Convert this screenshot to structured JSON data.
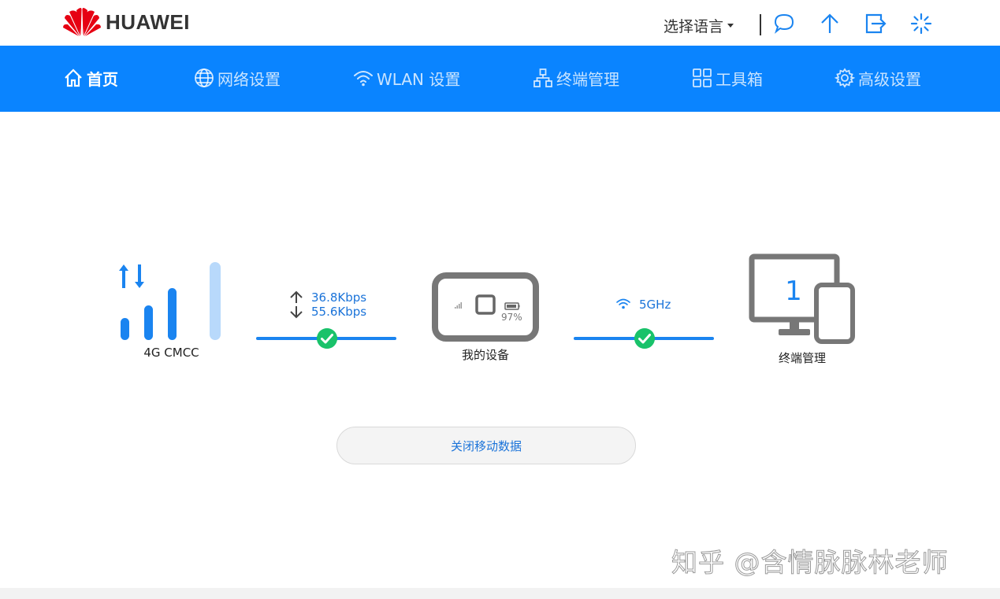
{
  "brand": {
    "name": "HUAWEI",
    "color": "#e60012"
  },
  "header": {
    "language_label": "选择语言",
    "icons": [
      "message-icon",
      "upload-icon",
      "logout-icon",
      "loading-icon"
    ]
  },
  "nav": {
    "accent": "#0a84ff",
    "items": [
      {
        "label": "首页",
        "icon": "home-icon",
        "active": true
      },
      {
        "label": "网络设置",
        "icon": "globe-icon",
        "active": false
      },
      {
        "label": "WLAN 设置",
        "icon": "wifi-icon",
        "active": false
      },
      {
        "label": "终端管理",
        "icon": "network-icon",
        "active": false
      },
      {
        "label": "工具箱",
        "icon": "grid-icon",
        "active": false
      },
      {
        "label": "高级设置",
        "icon": "gear-icon",
        "active": false
      }
    ]
  },
  "status": {
    "network_label": "4G  CMCC",
    "upload_rate": "36.8Kbps",
    "download_rate": "55.6Kbps",
    "device_label": "我的设备",
    "battery_percent": "97%",
    "wifi_band": "5GHz",
    "clients_count": "1",
    "clients_label": "终端管理",
    "link_ok_color": "#19c26a"
  },
  "actions": {
    "mobile_data_button": "关闭移动数据"
  },
  "watermark": "知乎 @含情脉脉林老师"
}
